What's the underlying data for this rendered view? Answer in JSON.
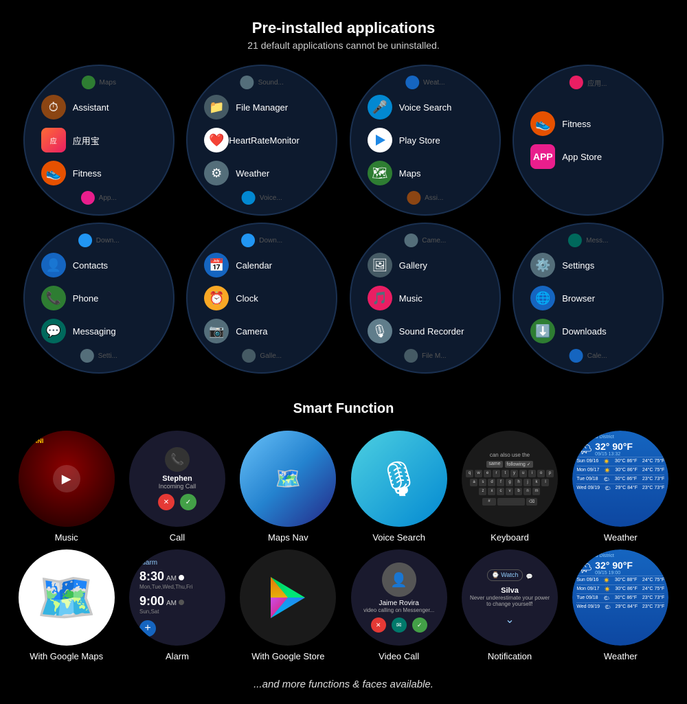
{
  "page": {
    "title": "Pre-installed applications",
    "subtitle": "21 default applications cannot be uninstalled.",
    "smart_title": "Smart Function",
    "footer": "...and more functions & faces available."
  },
  "app_circles": [
    {
      "peek_top": "Maps",
      "apps": [
        {
          "icon": "assistant",
          "label": "Assistant",
          "color": "#8B4513"
        },
        {
          "icon": "app-baidu",
          "label": "应用宝",
          "color": "baidu"
        },
        {
          "icon": "fitness",
          "label": "Fitness",
          "color": "#E65100"
        }
      ],
      "peek_bottom": "App..."
    },
    {
      "peek_top": "Sound",
      "apps": [
        {
          "icon": "folder",
          "label": "File Manager",
          "color": "#455A64"
        },
        {
          "icon": "heart",
          "label": "HeartRateMonitor",
          "color": "#fff"
        },
        {
          "icon": "weather",
          "label": "Weather",
          "color": "#546E7A"
        }
      ],
      "peek_bottom": "Voice..."
    },
    {
      "peek_top": "Weat...",
      "apps": [
        {
          "icon": "voice",
          "label": "Voice Search",
          "color": "#0288D1"
        },
        {
          "icon": "play",
          "label": "Play Store",
          "color": "#fff"
        },
        {
          "icon": "maps",
          "label": "Maps",
          "color": "#2E7D32"
        }
      ],
      "peek_bottom": "Assi..."
    },
    {
      "peek_top": "应用...",
      "apps": [
        {
          "icon": "fitness2",
          "label": "Fitness",
          "color": "#E65100"
        },
        {
          "icon": "app-store",
          "label": "App Store",
          "color": "#e91e8c"
        },
        {
          "icon": "empty",
          "label": "",
          "color": ""
        }
      ],
      "peek_bottom": ""
    },
    {
      "peek_top": "Down...",
      "apps": [
        {
          "icon": "contacts",
          "label": "Contacts",
          "color": "#1565C0"
        },
        {
          "icon": "phone",
          "label": "Phone",
          "color": "#2E7D32"
        },
        {
          "icon": "messaging",
          "label": "Messaging",
          "color": "#00695C"
        }
      ],
      "peek_bottom": "Setti..."
    },
    {
      "peek_top": "Down...",
      "apps": [
        {
          "icon": "calendar",
          "label": "Calendar",
          "color": "#1565C0"
        },
        {
          "icon": "clock",
          "label": "Clock",
          "color": "#F9A825"
        },
        {
          "icon": "camera",
          "label": "Camera",
          "color": "#546E7A"
        }
      ],
      "peek_bottom": "Galle..."
    },
    {
      "peek_top": "Came...",
      "apps": [
        {
          "icon": "gallery",
          "label": "Gallery",
          "color": "#455A64"
        },
        {
          "icon": "music",
          "label": "Music",
          "color": "#E91E63"
        },
        {
          "icon": "sound-recorder",
          "label": "Sound Recorder",
          "color": "#607D8B"
        }
      ],
      "peek_bottom": "File M..."
    },
    {
      "peek_top": "Mess...",
      "apps": [
        {
          "icon": "settings",
          "label": "Settings",
          "color": "#546E7A"
        },
        {
          "icon": "browser",
          "label": "Browser",
          "color": "#1565C0"
        },
        {
          "icon": "downloads",
          "label": "Downloads",
          "color": "#2E7D32"
        }
      ],
      "peek_bottom": "Cale..."
    }
  ],
  "smart_functions": {
    "row1": [
      {
        "id": "music",
        "label": "Music"
      },
      {
        "id": "call",
        "label": "Call",
        "detail": {
          "name": "Stephen",
          "status": "Incoming Call"
        }
      },
      {
        "id": "maps-nav",
        "label": "Maps Nav"
      },
      {
        "id": "voice-search",
        "label": "Voice Search"
      },
      {
        "id": "keyboard",
        "label": "Keyboard"
      },
      {
        "id": "weather",
        "label": "Weather",
        "detail": {
          "location": "Longgand District",
          "temp": "32° 90°F",
          "rows": [
            {
              "day": "Sun 09/16",
              "icon": "☀️",
              "hi": "30°C 86°F",
              "lo": "24°C 75°F"
            },
            {
              "day": "Mon 09/17",
              "icon": "☀️",
              "hi": "30°C 86°F",
              "lo": "24°C 75°F"
            },
            {
              "day": "Tue 09/18",
              "icon": "🌤",
              "hi": "30°C 86°F",
              "lo": "23°C 73°F"
            },
            {
              "day": "Wed 09/19",
              "icon": "🌤",
              "hi": "29°C 84°F",
              "lo": "23°C 73°F"
            }
          ]
        }
      }
    ],
    "row2": [
      {
        "id": "google-maps",
        "label": "With Google Maps"
      },
      {
        "id": "alarm",
        "label": "Alarm",
        "detail": {
          "alarms": [
            {
              "time": "8:30",
              "ampm": "AM",
              "days": "Mon,Tue,Wed,Thu,Fri"
            },
            {
              "time": "9:00",
              "ampm": "AM",
              "days": "Sun,Sat"
            }
          ]
        }
      },
      {
        "id": "google-store",
        "label": "With Google Store"
      },
      {
        "id": "video-call",
        "label": "Video Call",
        "detail": {
          "name": "Jaime Rovira",
          "status": "video calling on Messenger..."
        }
      },
      {
        "id": "notification",
        "label": "Notification",
        "detail": {
          "name": "Silva",
          "text": "Never underestimate your power to change yourself!"
        }
      },
      {
        "id": "weather2",
        "label": "Weather"
      }
    ]
  }
}
